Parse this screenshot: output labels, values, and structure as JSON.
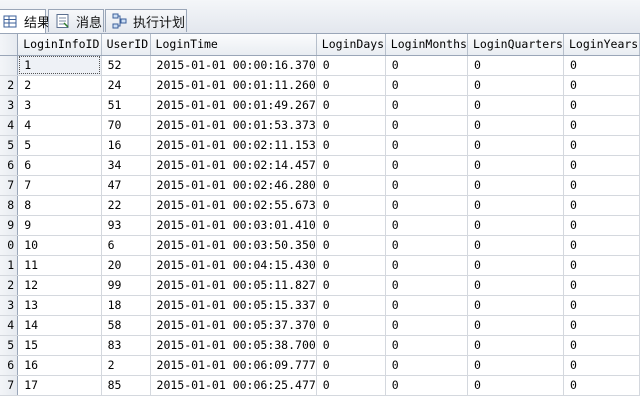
{
  "tabs": [
    {
      "label": "结果",
      "icon": "results-grid-icon",
      "active": true
    },
    {
      "label": "消息",
      "icon": "messages-icon",
      "active": false
    },
    {
      "label": "执行计划",
      "icon": "execution-plan-icon",
      "active": false
    }
  ],
  "grid": {
    "columns": [
      "LoginInfoID",
      "UserID",
      "LoginTime",
      "LoginDays",
      "LoginMonths",
      "LoginQuarters",
      "LoginYears"
    ],
    "row_numbers": [
      "",
      "2",
      "3",
      "4",
      "5",
      "6",
      "7",
      "8",
      "9",
      "0",
      "1",
      "2",
      "3",
      "4",
      "5",
      "6",
      "7"
    ],
    "rows": [
      [
        "1",
        "52",
        "2015-01-01 00:00:16.370",
        "0",
        "0",
        "0",
        "0"
      ],
      [
        "2",
        "24",
        "2015-01-01 00:01:11.260",
        "0",
        "0",
        "0",
        "0"
      ],
      [
        "3",
        "51",
        "2015-01-01 00:01:49.267",
        "0",
        "0",
        "0",
        "0"
      ],
      [
        "4",
        "70",
        "2015-01-01 00:01:53.373",
        "0",
        "0",
        "0",
        "0"
      ],
      [
        "5",
        "16",
        "2015-01-01 00:02:11.153",
        "0",
        "0",
        "0",
        "0"
      ],
      [
        "6",
        "34",
        "2015-01-01 00:02:14.457",
        "0",
        "0",
        "0",
        "0"
      ],
      [
        "7",
        "47",
        "2015-01-01 00:02:46.280",
        "0",
        "0",
        "0",
        "0"
      ],
      [
        "8",
        "22",
        "2015-01-01 00:02:55.673",
        "0",
        "0",
        "0",
        "0"
      ],
      [
        "9",
        "93",
        "2015-01-01 00:03:01.410",
        "0",
        "0",
        "0",
        "0"
      ],
      [
        "10",
        "6",
        "2015-01-01 00:03:50.350",
        "0",
        "0",
        "0",
        "0"
      ],
      [
        "11",
        "20",
        "2015-01-01 00:04:15.430",
        "0",
        "0",
        "0",
        "0"
      ],
      [
        "12",
        "99",
        "2015-01-01 00:05:11.827",
        "0",
        "0",
        "0",
        "0"
      ],
      [
        "13",
        "18",
        "2015-01-01 00:05:15.337",
        "0",
        "0",
        "0",
        "0"
      ],
      [
        "14",
        "58",
        "2015-01-01 00:05:37.370",
        "0",
        "0",
        "0",
        "0"
      ],
      [
        "15",
        "83",
        "2015-01-01 00:05:38.700",
        "0",
        "0",
        "0",
        "0"
      ],
      [
        "16",
        "2",
        "2015-01-01 00:06:09.777",
        "0",
        "0",
        "0",
        "0"
      ],
      [
        "17",
        "85",
        "2015-01-01 00:06:25.477",
        "0",
        "0",
        "0",
        "0"
      ]
    ]
  }
}
